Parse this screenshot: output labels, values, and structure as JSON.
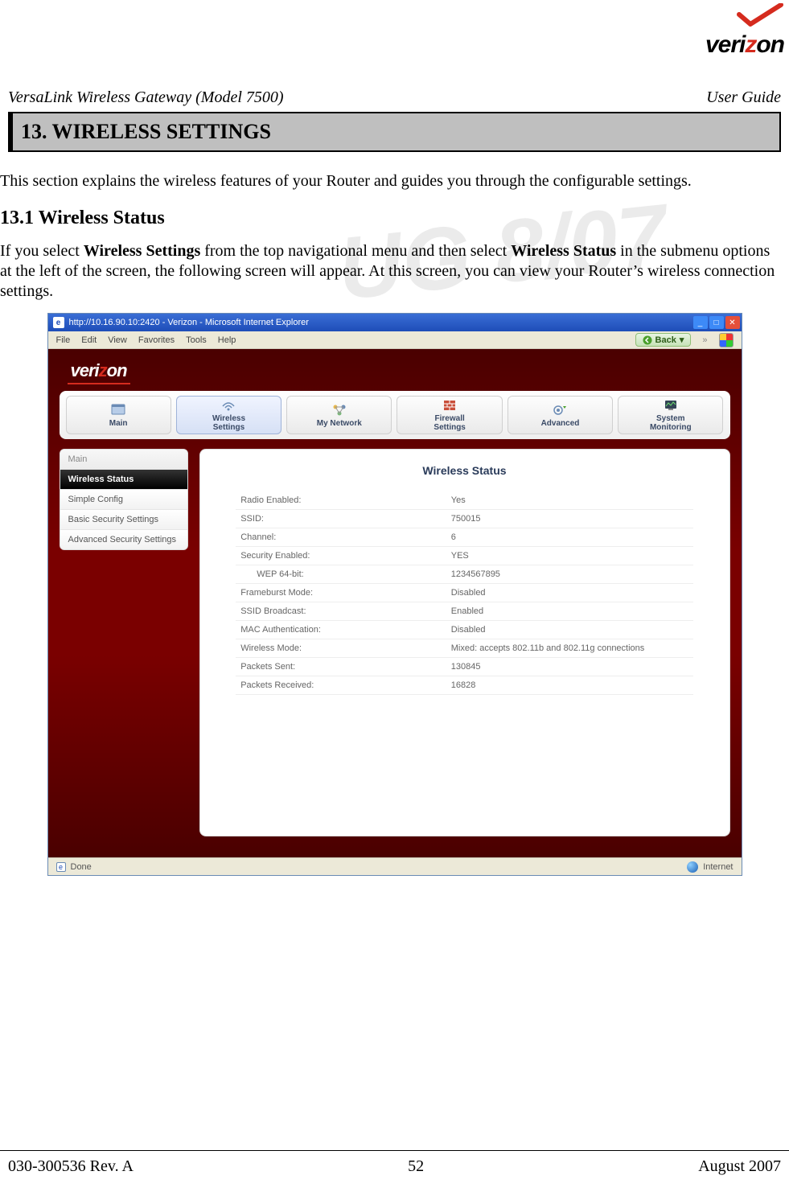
{
  "logo_text_pre": "veri",
  "logo_text_mid": "z",
  "logo_text_post": "on",
  "doc_title_left": "VersaLink Wireless Gateway (Model 7500)",
  "doc_title_right": "User Guide",
  "section_heading": "13. WIRELESS SETTINGS",
  "intro_para": "This section explains the wireless features of your Router and guides you through the configurable settings.",
  "sub_heading": "13.1 Wireless Status",
  "body_para_1a": "If you select ",
  "body_para_1b": "Wireless Settings",
  "body_para_1c": " from the top navigational menu and then select ",
  "body_para_1d": "Wireless Status",
  "body_para_1e": " in the submenu options at the left of the screen, the following screen will appear. At this screen, you can view your Router’s wireless connection settings.",
  "watermark_text": "UG   8/07",
  "browser": {
    "title": "http://10.16.90.10:2420 - Verizon - Microsoft Internet Explorer",
    "menu": [
      "File",
      "Edit",
      "View",
      "Favorites",
      "Tools",
      "Help"
    ],
    "back_label": "Back",
    "status_done": "Done",
    "status_net": "Internet"
  },
  "top_tabs": [
    {
      "label": "Main"
    },
    {
      "label": "Wireless\nSettings"
    },
    {
      "label": "My Network"
    },
    {
      "label": "Firewall\nSettings"
    },
    {
      "label": "Advanced"
    },
    {
      "label": "System\nMonitoring"
    }
  ],
  "sidebar": {
    "header": "Main",
    "items": [
      {
        "label": "Wireless Status",
        "active": true
      },
      {
        "label": "Simple Config"
      },
      {
        "label": "Basic Security Settings"
      },
      {
        "label": "Advanced Security Settings"
      }
    ]
  },
  "panel": {
    "title": "Wireless Status",
    "rows": [
      {
        "k": "Radio Enabled:",
        "v": "Yes"
      },
      {
        "k": "SSID:",
        "v": "750015"
      },
      {
        "k": "Channel:",
        "v": "6"
      },
      {
        "k": "Security Enabled:",
        "v": "YES"
      },
      {
        "k": "WEP 64-bit:",
        "v": "1234567895",
        "indent": true
      },
      {
        "k": "Frameburst Mode:",
        "v": "Disabled"
      },
      {
        "k": "SSID Broadcast:",
        "v": "Enabled"
      },
      {
        "k": "MAC Authentication:",
        "v": "Disabled"
      },
      {
        "k": "Wireless Mode:",
        "v": "Mixed: accepts 802.11b and 802.11g connections"
      },
      {
        "k": "Packets Sent:",
        "v": "130845"
      },
      {
        "k": "Packets Received:",
        "v": "16828"
      }
    ]
  },
  "footer": {
    "left": "030-300536 Rev. A",
    "center": "52",
    "right": "August 2007"
  }
}
